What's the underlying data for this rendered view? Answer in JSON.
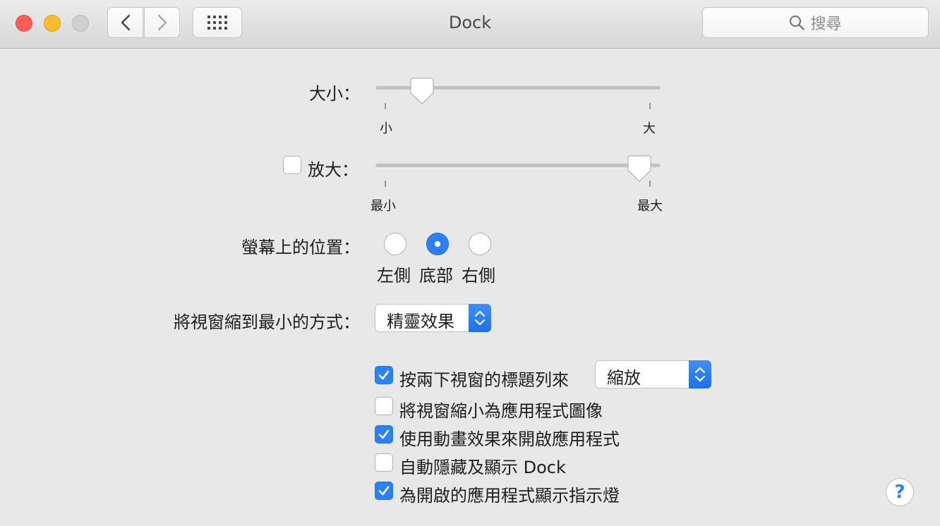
{
  "window": {
    "title": "Dock",
    "search_placeholder": "搜尋",
    "nav_icons": [
      "back-chevron-icon",
      "forward-chevron-icon",
      "grid-icon",
      "search-icon"
    ]
  },
  "size": {
    "label": "大小：",
    "min_label": "小",
    "max_label": "大",
    "value_fraction": 0.14
  },
  "magnification": {
    "label": "放大：",
    "enabled": false,
    "min_label": "最小",
    "max_label": "最大",
    "value_fraction": 0.96
  },
  "position": {
    "label": "螢幕上的位置：",
    "options": [
      "左側",
      "底部",
      "右側"
    ],
    "selected": "底部"
  },
  "minimize_effect": {
    "label": "將視窗縮到最小的方式：",
    "value": "精靈效果"
  },
  "options": [
    {
      "label": "按兩下視窗的標題列來",
      "checked": true,
      "popup_value": "縮放"
    },
    {
      "label": "將視窗縮小為應用程式圖像",
      "checked": false
    },
    {
      "label": "使用動畫效果來開啟應用程式",
      "checked": true
    },
    {
      "label": "自動隱藏及顯示 Dock",
      "checked": false
    },
    {
      "label": "為開啟的應用程式顯示指示燈",
      "checked": true
    }
  ],
  "help": {
    "label": "?"
  },
  "colors": {
    "accent": "#2f80f6",
    "close": "#fc5f57",
    "minimize": "#fdbc2e",
    "zoom_inactive": "#cfcfcf"
  }
}
